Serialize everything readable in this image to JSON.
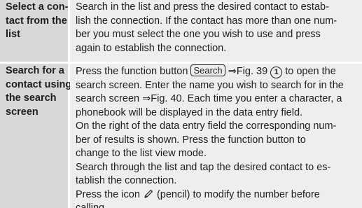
{
  "rows": [
    {
      "label_lines": [
        "Select a con-",
        "tact from the",
        "list"
      ],
      "text_lines": [
        "Search in the list and press the desired contact to estab-",
        "lish the connection. If the contact has more than one num-",
        "ber you must select the one you wish to use and press",
        "again to establish the connection."
      ]
    },
    {
      "label_lines": [
        "Search for a",
        "contact using",
        "the search",
        "screen"
      ],
      "line1": {
        "pre": "Press the function button ",
        "button": "Search",
        "arrow_ref": "⇒Fig. 39 ",
        "circle": "1",
        "post": " to open the"
      },
      "line2": "search screen. Enter the name you wish to search for in the",
      "line3": {
        "pre": "search screen ",
        "ref": "⇒Fig. 40",
        "post": ". Each time you enter a character, a"
      },
      "more_lines": [
        "phonebook will be displayed in the data entry field.",
        "On the right of the data entry field the corresponding num-",
        "ber of results is shown. Press the function button to",
        "change to the list view mode.",
        "Search through the list and tap the desired contact to es-",
        "tablish the connection."
      ],
      "pencil_line": {
        "pre": "Press the icon ",
        "icon": "pencil-icon",
        "post": " (pencil) to modify the number before"
      },
      "last_line": "calling."
    }
  ],
  "colors": {
    "label_bg": "#d8d8d8",
    "text_bg": "#eeeeee",
    "text": "#1e1e1e"
  }
}
